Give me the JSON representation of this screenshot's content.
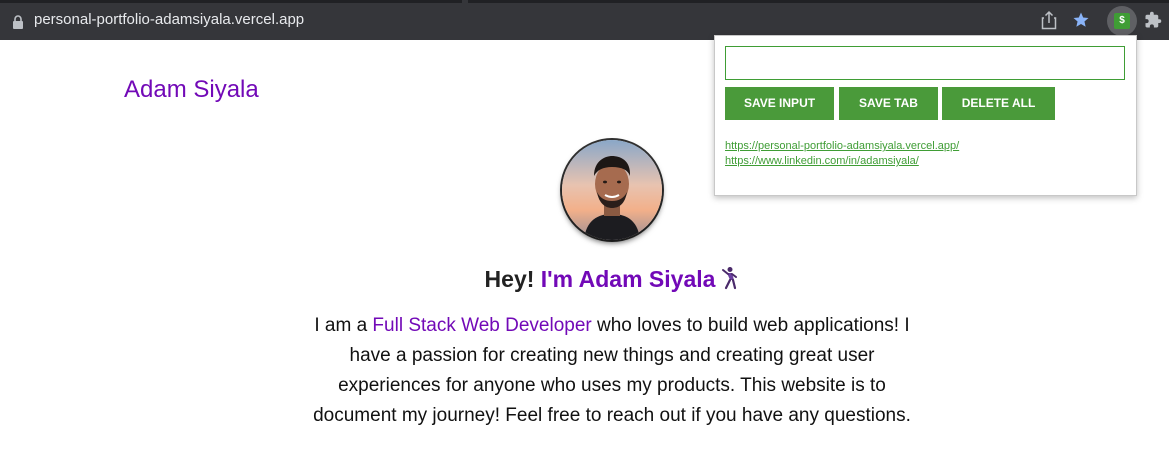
{
  "browser": {
    "url": "personal-portfolio-adamsiyala.vercel.app",
    "extension_badge": "$"
  },
  "page": {
    "site_name": "Adam Siyala",
    "greeting_prefix": "Hey! ",
    "greeting_name": "I'm Adam Siyala",
    "bio_prefix": "I am a ",
    "bio_role": "Full Stack Web Developer",
    "bio_rest": " who loves to build web applications! I have a passion for creating new things and creating great user experiences for anyone who uses my products. This website is to document my journey! Feel free to reach out if you have any questions.",
    "accent_color": "#7209b7"
  },
  "popup": {
    "input_value": "",
    "buttons": {
      "save_input": "SAVE INPUT",
      "save_tab": "SAVE TAB",
      "delete_all": "DELETE ALL"
    },
    "saved_links": [
      "https://personal-portfolio-adamsiyala.vercel.app/",
      "https://www.linkedin.com/in/adamsiyala/"
    ],
    "accent_color": "#4a9a3a"
  },
  "icons": {
    "lock": "lock-icon",
    "share": "share-icon",
    "bookmark": "star-icon",
    "extension": "dollar-extension-icon",
    "extensions_menu": "puzzle-icon",
    "greeting_emoji": "dancer-icon"
  }
}
